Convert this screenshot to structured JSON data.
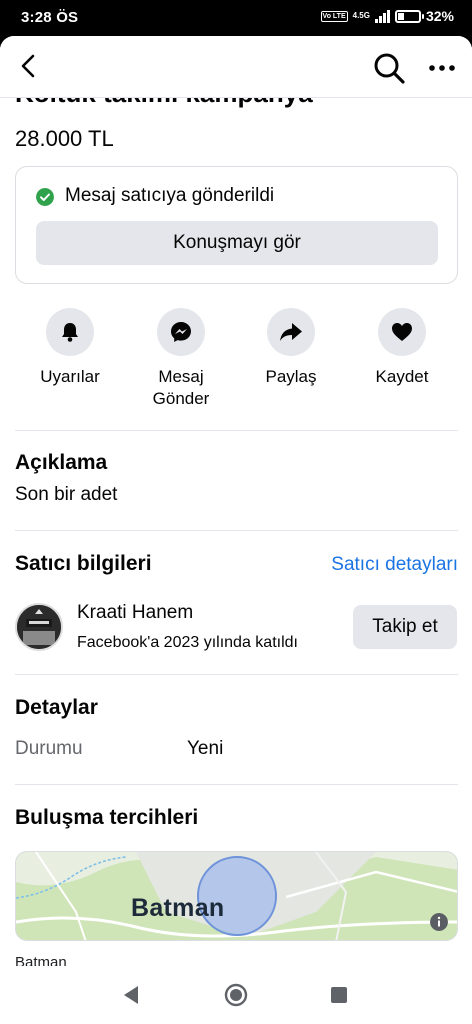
{
  "status_bar": {
    "time": "3:28 ÖS",
    "volte": "Vo LTE",
    "network": "4.5G",
    "battery": "32%",
    "battery_level": 0.32
  },
  "top_bar": {
    "back_icon": "chevron-left-icon",
    "search_icon": "search-icon",
    "more_icon": "more-horizontal-icon"
  },
  "listing": {
    "title": "Koltuk takımı kampanya",
    "price": "28.000 TL"
  },
  "message_card": {
    "status_text": "Mesaj satıcıya gönderildi",
    "view_button": "Konuşmayı gör",
    "status_color": "#31a24c"
  },
  "actions": [
    {
      "label": "Uyarılar",
      "icon": "bell-icon"
    },
    {
      "label": "Mesaj Gönder",
      "icon": "messenger-icon"
    },
    {
      "label": "Paylaş",
      "icon": "share-icon"
    },
    {
      "label": "Kaydet",
      "icon": "heart-icon"
    }
  ],
  "description": {
    "heading": "Açıklama",
    "text": "Son bir adet"
  },
  "seller": {
    "heading": "Satıcı bilgileri",
    "details_link": "Satıcı detayları",
    "name": "Kraati Hanem",
    "joined": "Facebook'a 2023 yılında katıldı",
    "follow_button": "Takip et",
    "link_color": "#1b74e4"
  },
  "details": {
    "heading": "Detaylar",
    "condition_label": "Durumu",
    "condition_value": "Yeni"
  },
  "meetup": {
    "heading": "Buluşma tercihleri",
    "map_label": "Batman",
    "location": "Batman"
  },
  "nav_bar": {
    "back_icon": "nav-back-icon",
    "home_icon": "nav-home-icon",
    "recents_icon": "nav-recents-icon"
  }
}
